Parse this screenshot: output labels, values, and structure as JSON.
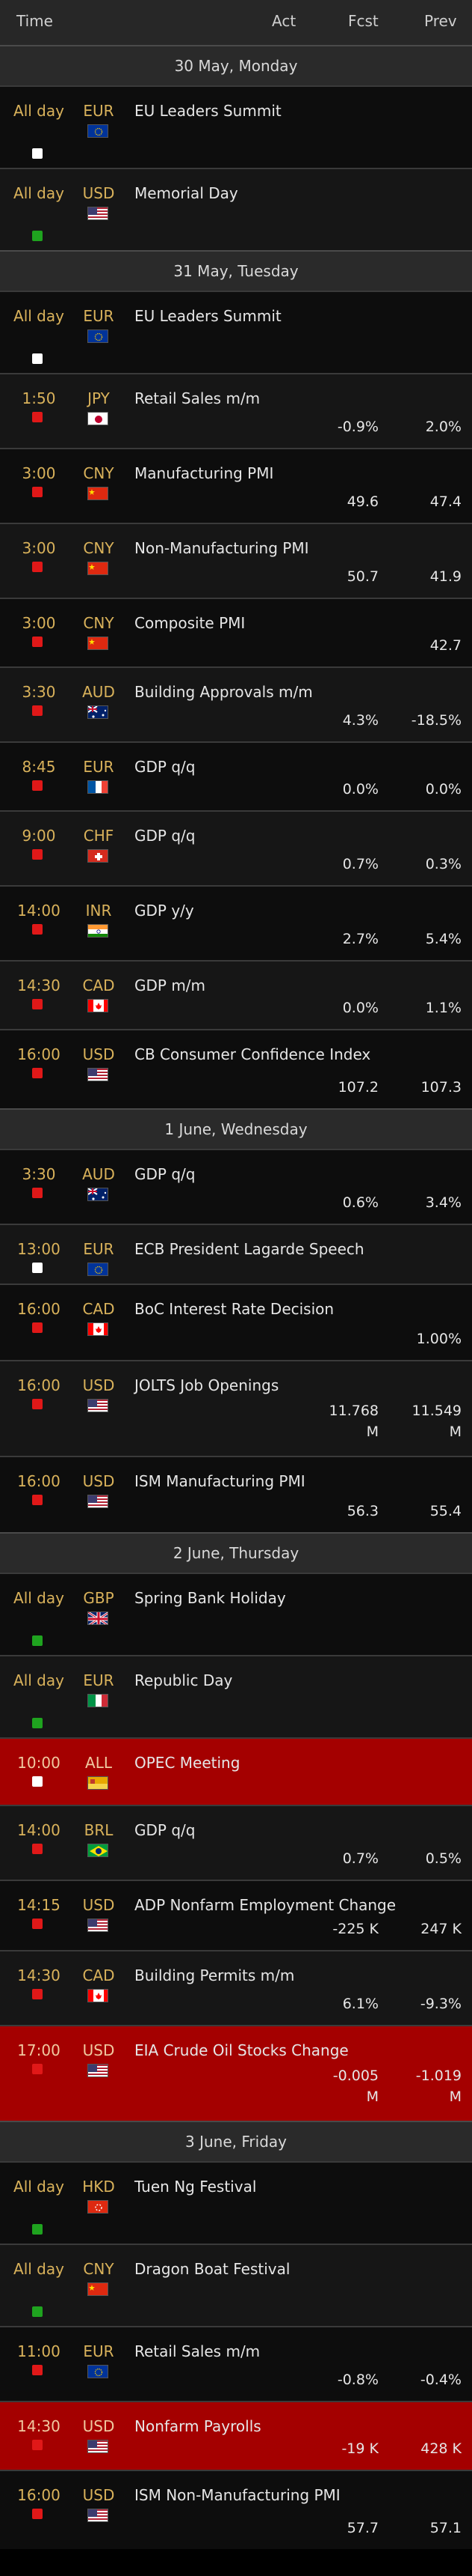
{
  "header": {
    "time": "Time",
    "act": "Act",
    "fcst": "Fcst",
    "prev": "Prev"
  },
  "days": [
    {
      "label": "30 May, Monday",
      "events": [
        {
          "time": "All day",
          "cur": "EUR",
          "flag": "eu-flag-icon",
          "imp": "low",
          "title": "EU Leaders Summit",
          "fcst": "",
          "prev": "",
          "h": 110
        },
        {
          "time": "All day",
          "cur": "USD",
          "flag": "us-flag-icon",
          "imp": "holiday",
          "title": "Memorial Day",
          "fcst": "",
          "prev": "",
          "h": 110
        }
      ]
    },
    {
      "label": "31 May, Tuesday",
      "events": [
        {
          "time": "All day",
          "cur": "EUR",
          "flag": "eu-flag-icon",
          "imp": "low",
          "title": "EU Leaders Summit",
          "fcst": "",
          "prev": "",
          "h": 110
        },
        {
          "time": "1:50",
          "cur": "JPY",
          "flag": "jp-flag-icon",
          "imp": "high",
          "title": "Retail Sales m/m",
          "fcst": "-0.9%",
          "prev": "2.0%",
          "h": 100
        },
        {
          "time": "3:00",
          "cur": "CNY",
          "flag": "cn-flag-icon",
          "imp": "high",
          "title": "Manufacturing PMI",
          "fcst": "49.6",
          "prev": "47.4",
          "h": 100
        },
        {
          "time": "3:00",
          "cur": "CNY",
          "flag": "cn-flag-icon",
          "imp": "high",
          "title": "Non-Manufacturing PMI",
          "fcst": "50.7",
          "prev": "41.9",
          "h": 100
        },
        {
          "time": "3:00",
          "cur": "CNY",
          "flag": "cn-flag-icon",
          "imp": "high",
          "title": "Composite PMI",
          "fcst": "",
          "prev": "42.7",
          "h": 92
        },
        {
          "time": "3:30",
          "cur": "AUD",
          "flag": "au-flag-icon",
          "imp": "high",
          "title": "Building Approvals m/m",
          "fcst": "4.3%",
          "prev": "-18.5%",
          "h": 100
        },
        {
          "time": "8:45",
          "cur": "EUR",
          "flag": "fr-flag-icon",
          "imp": "high",
          "title": "GDP q/q",
          "fcst": "0.0%",
          "prev": "0.0%",
          "h": 92
        },
        {
          "time": "9:00",
          "cur": "CHF",
          "flag": "ch-flag-icon",
          "imp": "high",
          "title": "GDP q/q",
          "fcst": "0.7%",
          "prev": "0.3%",
          "h": 100
        },
        {
          "time": "14:00",
          "cur": "INR",
          "flag": "in-flag-icon",
          "imp": "high",
          "title": "GDP y/y",
          "fcst": "2.7%",
          "prev": "5.4%",
          "h": 100
        },
        {
          "time": "14:30",
          "cur": "CAD",
          "flag": "ca-flag-icon",
          "imp": "high",
          "title": "GDP m/m",
          "fcst": "0.0%",
          "prev": "1.1%",
          "h": 92
        },
        {
          "time": "16:00",
          "cur": "USD",
          "flag": "us-flag-icon",
          "imp": "high",
          "title": "CB Consumer Confidence Index",
          "fcst": "107.2",
          "prev": "107.3",
          "h": 106
        }
      ]
    },
    {
      "label": "1 June, Wednesday",
      "events": [
        {
          "time": "3:30",
          "cur": "AUD",
          "flag": "au-flag-icon",
          "imp": "high",
          "title": "GDP q/q",
          "fcst": "0.6%",
          "prev": "3.4%",
          "h": 100
        },
        {
          "time": "13:00",
          "cur": "EUR",
          "flag": "eu-flag-icon",
          "imp": "low",
          "title": "ECB President Lagarde Speech",
          "fcst": "",
          "prev": "",
          "h": 80
        },
        {
          "time": "16:00",
          "cur": "CAD",
          "flag": "ca-flag-icon",
          "imp": "high",
          "title": "BoC Interest Rate Decision",
          "fcst": "",
          "prev": "1.00%",
          "h": 102
        },
        {
          "time": "16:00",
          "cur": "USD",
          "flag": "us-flag-icon",
          "imp": "high",
          "title": "JOLTS Job Openings",
          "fcst": "11.768\nM",
          "prev": "11.549\nM",
          "h": 128
        },
        {
          "time": "16:00",
          "cur": "USD",
          "flag": "us-flag-icon",
          "imp": "high",
          "title": "ISM Manufacturing PMI",
          "fcst": "56.3",
          "prev": "55.4",
          "h": 102
        }
      ]
    },
    {
      "label": "2 June, Thursday",
      "events": [
        {
          "time": "All day",
          "cur": "GBP",
          "flag": "gb-flag-icon",
          "imp": "holiday",
          "title": "Spring Bank Holiday",
          "fcst": "",
          "prev": "",
          "h": 110
        },
        {
          "time": "All day",
          "cur": "EUR",
          "flag": "it-flag-icon",
          "imp": "holiday",
          "title": "Republic Day",
          "fcst": "",
          "prev": "",
          "h": 110
        },
        {
          "time": "10:00",
          "cur": "ALL",
          "flag": "all-flag-icon",
          "imp": "low",
          "title": "OPEC Meeting",
          "fcst": "",
          "prev": "",
          "h": 90,
          "hi": true
        },
        {
          "time": "14:00",
          "cur": "BRL",
          "flag": "br-flag-icon",
          "imp": "high",
          "title": "GDP q/q",
          "fcst": "0.7%",
          "prev": "0.5%",
          "h": 100
        },
        {
          "time": "14:15",
          "cur": "USD",
          "flag": "us-flag-icon",
          "imp": "high",
          "title": "ADP Nonfarm Employment Change",
          "fcst": "-225 K",
          "prev": "247 K",
          "h": 94
        },
        {
          "time": "14:30",
          "cur": "CAD",
          "flag": "ca-flag-icon",
          "imp": "high",
          "title": "Building Permits m/m",
          "fcst": "6.1%",
          "prev": "-9.3%",
          "h": 100
        },
        {
          "time": "17:00",
          "cur": "USD",
          "flag": "us-flag-icon",
          "imp": "high",
          "title": "EIA Crude Oil Stocks Change",
          "fcst": "-0.005\nM",
          "prev": "-1.019\nM",
          "h": 128,
          "hi": true
        }
      ]
    },
    {
      "label": "3 June, Friday",
      "events": [
        {
          "time": "All day",
          "cur": "HKD",
          "flag": "hk-flag-icon",
          "imp": "holiday",
          "title": "Tuen Ng Festival",
          "fcst": "",
          "prev": "",
          "h": 110
        },
        {
          "time": "All day",
          "cur": "CNY",
          "flag": "cn-flag-icon",
          "imp": "holiday",
          "title": "Dragon Boat Festival",
          "fcst": "",
          "prev": "",
          "h": 110
        },
        {
          "time": "11:00",
          "cur": "EUR",
          "flag": "eu-flag-icon",
          "imp": "high",
          "title": "Retail Sales m/m",
          "fcst": "-0.8%",
          "prev": "-0.4%",
          "h": 100
        },
        {
          "time": "14:30",
          "cur": "USD",
          "flag": "us-flag-icon",
          "imp": "high",
          "title": "Nonfarm Payrolls",
          "fcst": "-19 K",
          "prev": "428 K",
          "h": 92,
          "hi": true
        },
        {
          "time": "16:00",
          "cur": "USD",
          "flag": "us-flag-icon",
          "imp": "high",
          "title": "ISM Non-Manufacturing PMI",
          "fcst": "57.7",
          "prev": "57.1",
          "h": 106
        }
      ]
    }
  ]
}
